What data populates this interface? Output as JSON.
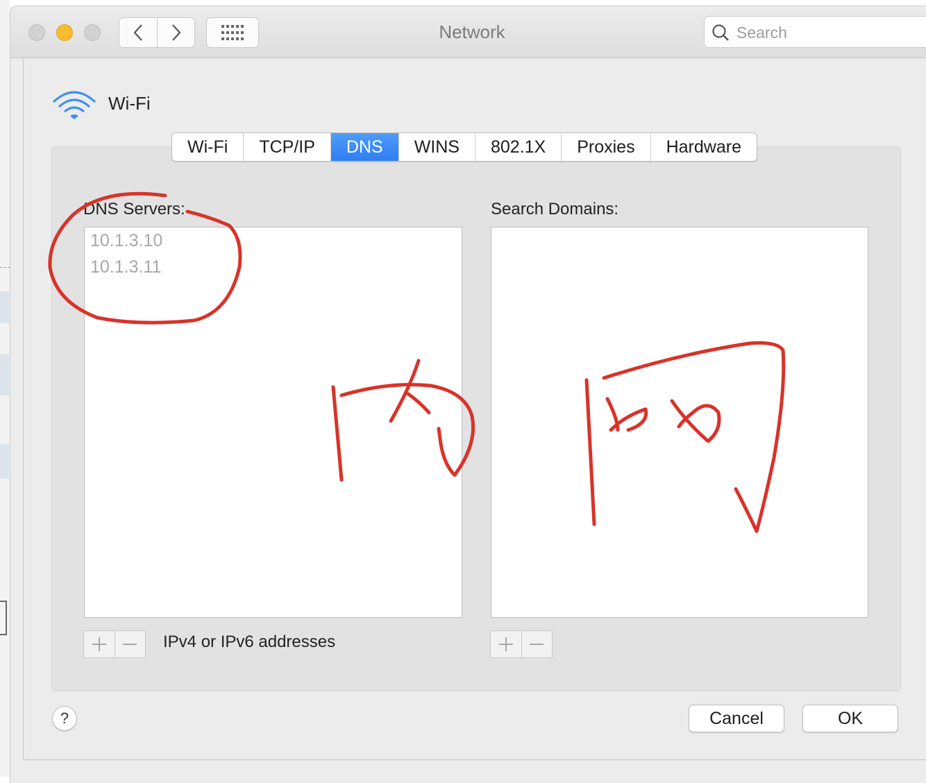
{
  "window": {
    "title": "Network"
  },
  "toolbar": {
    "search_placeholder": "Search"
  },
  "interface": {
    "name": "Wi-Fi"
  },
  "tabs": [
    {
      "label": "Wi-Fi"
    },
    {
      "label": "TCP/IP"
    },
    {
      "label": "DNS",
      "active": true
    },
    {
      "label": "WINS"
    },
    {
      "label": "802.1X"
    },
    {
      "label": "Proxies"
    },
    {
      "label": "Hardware"
    }
  ],
  "dns": {
    "servers_label": "DNS Servers:",
    "servers": [
      "10.1.3.10",
      "10.1.3.11"
    ],
    "hint": "IPv4 or IPv6 addresses"
  },
  "search_domains": {
    "label": "Search Domains:",
    "items": []
  },
  "buttons": {
    "help": "?",
    "cancel": "Cancel",
    "ok": "OK"
  },
  "colors": {
    "accent": "#2f7ef2",
    "annotation": "#d8332a",
    "minimize": "#f7bd2f"
  }
}
